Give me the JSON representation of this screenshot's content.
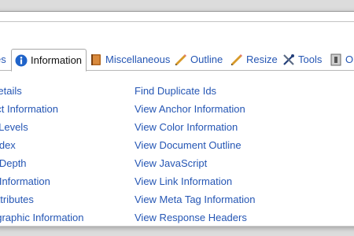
{
  "tabs": [
    {
      "label": "es",
      "icon": ""
    },
    {
      "label": "Information",
      "icon": "info-icon"
    },
    {
      "label": "Miscellaneous",
      "icon": "book-icon"
    },
    {
      "label": "Outline",
      "icon": "pencil-icon"
    },
    {
      "label": "Resize",
      "icon": "pencil-icon"
    },
    {
      "label": "Tools",
      "icon": "tools-icon"
    },
    {
      "label": "Op",
      "icon": "options-icon"
    }
  ],
  "active_tab": "Information",
  "left_column": [
    "Details",
    "ect Information",
    "k Levels",
    "Index",
    "e Depth",
    "e Information",
    "Attributes",
    "ographic Information"
  ],
  "right_column": [
    "Find Duplicate Ids",
    "View Anchor Information",
    "View Color Information",
    "View Document Outline",
    "View JavaScript",
    "View Link Information",
    "View Meta Tag Information",
    "View Response Headers"
  ],
  "colors": {
    "link": "#2556b4",
    "info_icon": "#1f63c9",
    "book_icon": "#b0641e",
    "pencil_icon": "#d89a2a",
    "tools_icon": "#233f7a"
  }
}
